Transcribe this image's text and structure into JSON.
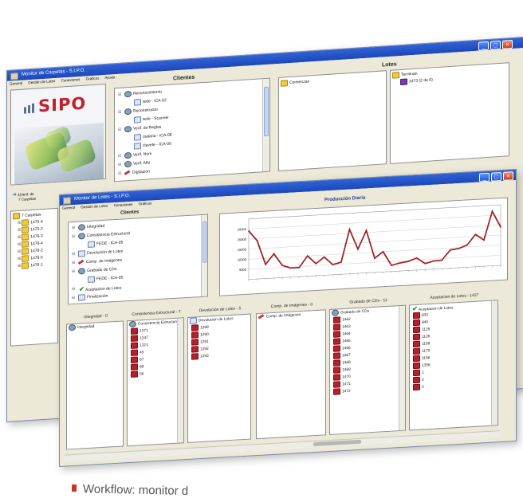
{
  "back_window": {
    "title": "Monitor de Carpetas - S.I.P.O.",
    "menu": [
      "General",
      "Gestión de Lotes",
      "Conexiones",
      "Gráficos",
      "Ayuda"
    ],
    "logo_text": "SIPO",
    "clientes_title": "Clientes",
    "lotes_title": "Lotes",
    "clientes_tree": [
      {
        "label": "Reconocimiento",
        "icon": "gear-icon"
      },
      {
        "label": "tede - ICA-02",
        "icon": "doc-icon",
        "indent": 1
      },
      {
        "label": "Reconstructor",
        "icon": "gear-icon"
      },
      {
        "label": "tede - Scanner",
        "icon": "doc-icon",
        "indent": 1
      },
      {
        "label": "Verif. de Reglas",
        "icon": "gear-icon"
      },
      {
        "label": "malaria - ICA-08",
        "icon": "doc-icon",
        "indent": 1
      },
      {
        "label": "clavete - ICA-08",
        "icon": "doc-icon",
        "indent": 1
      },
      {
        "label": "Verif. Num",
        "icon": "gear-icon"
      },
      {
        "label": "Verif. Alfa",
        "icon": "gear-icon"
      },
      {
        "label": "Digitacion",
        "icon": "pen-icon"
      }
    ],
    "comienzan_label": "Comienzan",
    "terminan_label": "Terminan",
    "terminan_item": "1473 (2 de 6)",
    "left_info": [
      "4(Verif. de",
      "7 Carpetas"
    ],
    "carpetas_root": "7 Carpetas",
    "carpetas": [
      "1475-4",
      "1475-2",
      "1476-3",
      "1476-4",
      "1476-2",
      "1476-5",
      "1476-1"
    ]
  },
  "front_window": {
    "title": "Monitor de Lotes - S.I.P.O.",
    "menu": [
      "General",
      "Gestión de Lotes",
      "Conexiones",
      "Gráficos"
    ],
    "clientes_title": "Clientes",
    "produccion_title": "Producción Diaria",
    "clientes_tree": [
      {
        "label": "Integridad",
        "icon": "gear-icon"
      },
      {
        "label": "Consistencia Estructural",
        "icon": "gear-icon"
      },
      {
        "label": "FEDE - ICA-05",
        "icon": "doc-icon",
        "indent": 1
      },
      {
        "label": "Devolución de Lotes",
        "icon": "doc-icon"
      },
      {
        "label": "Comp. de Imágenes",
        "icon": "pen-icon"
      },
      {
        "label": "Grabado de CDs",
        "icon": "gear-icon"
      },
      {
        "label": "FEDE - ICA-05",
        "icon": "doc-icon",
        "indent": 1
      },
      {
        "label": "Aceptacion de Lotes",
        "icon": "check-icon"
      },
      {
        "label": "Finalización",
        "icon": "doc-icon"
      }
    ],
    "columns": [
      {
        "header": "Integridad - 0",
        "root": "Integridad",
        "root_icon": "gear-icon",
        "items": []
      },
      {
        "header": "Consistencia Estructural - 7",
        "root": "Consistencia Estructural",
        "root_icon": "gear-icon",
        "items": [
          "1371",
          "1247",
          "1321",
          "45",
          "67",
          "89",
          "56"
        ]
      },
      {
        "header": "Devolución de Lotes - 5",
        "root": "Devolución de Lotes",
        "root_icon": "doc-icon",
        "items": [
          "1289",
          "1290",
          "1291",
          "1292",
          "1293"
        ]
      },
      {
        "header": "Comp. de Imágenes - 0",
        "root": "Comp. de Imágenes",
        "root_icon": "pen-icon",
        "items": []
      },
      {
        "header": "Grabado de CDs - 11",
        "root": "Grabado de CDs",
        "root_icon": "gear-icon",
        "items": [
          "1462",
          "1463",
          "1464",
          "1465",
          "1466",
          "1467",
          "1468",
          "1469",
          "1470",
          "1471",
          "1472"
        ]
      },
      {
        "header": "Aceptacion de Lotes - 1427",
        "root": "Aceptacion de Lotes",
        "root_icon": "check-icon",
        "items": [
          "830",
          "840",
          "1125",
          "1126",
          "1169",
          "1170",
          "1156",
          "1356",
          "1",
          "2",
          "3"
        ]
      }
    ]
  },
  "chart_data": {
    "type": "line",
    "title": "Producción Diaria",
    "ylim": [
      0,
      30000
    ],
    "y_ticks": [
      5000,
      10000,
      15000,
      20000,
      25000
    ],
    "grid": true,
    "series": [
      {
        "color": "#a0262a",
        "values": [
          24000,
          19000,
          7000,
          12000,
          6000,
          4500,
          4500,
          10000,
          6000,
          9000,
          5000,
          6000,
          22000,
          12000,
          21000,
          7000,
          10000,
          3000,
          4000,
          4500,
          6000,
          3000,
          4000,
          4200,
          9000,
          9500,
          11000,
          16000,
          13000,
          27000,
          19000
        ]
      }
    ]
  },
  "caption": "Workflow: monitor d",
  "colors": {
    "titlebar": "#1d47b8",
    "series": "#a0262a",
    "logo": "#c0202a"
  }
}
